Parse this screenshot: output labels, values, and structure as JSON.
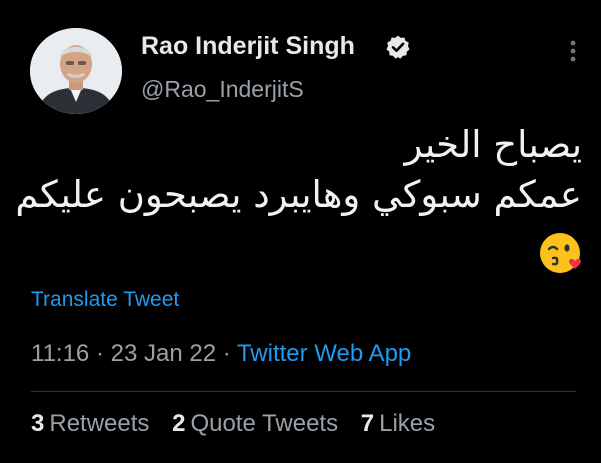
{
  "tweet": {
    "author": {
      "display_name": "Rao Inderjit Singh",
      "handle": "@Rao_InderjitS",
      "verified": true
    },
    "text_lines": [
      "يصباح الخير",
      "عمكم سبوكي وهايبرد يصبحون عليكم"
    ],
    "emoji": "face-throwing-a-kiss",
    "translate_label": "Translate Tweet",
    "time": "11:16",
    "date": "23 Jan 22",
    "source": "Twitter Web App",
    "separator": "·",
    "stats": [
      {
        "count": "3",
        "label": "Retweets"
      },
      {
        "count": "2",
        "label": "Quote Tweets"
      },
      {
        "count": "7",
        "label": "Likes"
      }
    ]
  },
  "icons": {
    "verified": "verified-badge-icon",
    "more": "more-options-icon"
  },
  "colors": {
    "background": "#000000",
    "text_primary": "#e7e9ea",
    "text_secondary": "#9aa1a7",
    "link": "#1d9bf0",
    "divider": "#2f3336"
  }
}
